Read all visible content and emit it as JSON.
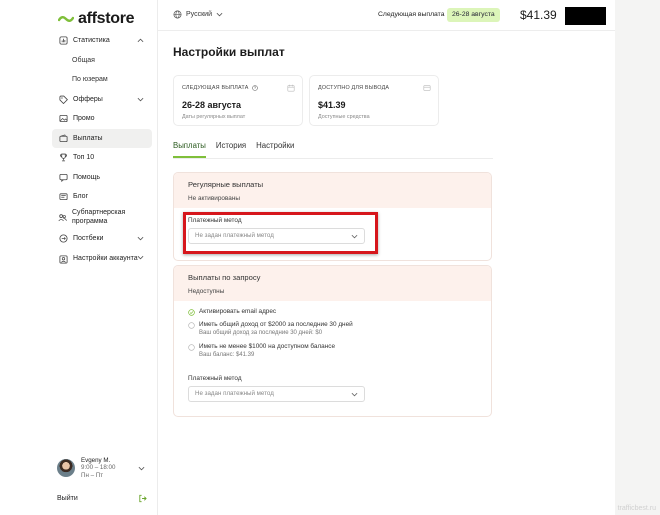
{
  "brand": {
    "name": "affstore",
    "accent": "#7fbf3a"
  },
  "sidebar": {
    "items": [
      {
        "label": "Статистика",
        "icon": "bar-chart-icon",
        "expanded": true,
        "children": [
          {
            "label": "Общая"
          },
          {
            "label": "По юзерам"
          }
        ]
      },
      {
        "label": "Офферы",
        "icon": "tag-icon",
        "chevron": true
      },
      {
        "label": "Промо",
        "icon": "image-icon"
      },
      {
        "label": "Выплаты",
        "icon": "wallet-icon",
        "active": true
      },
      {
        "label": "Топ 10",
        "icon": "trophy-icon"
      },
      {
        "label": "Помощь",
        "icon": "chat-icon"
      },
      {
        "label": "Блог",
        "icon": "doc-icon"
      },
      {
        "label": "Субпартнерская программа",
        "icon": "users-icon"
      },
      {
        "label": "Постбеки",
        "icon": "postback-icon",
        "chevron": true
      },
      {
        "label": "Настройки аккаунта",
        "icon": "user-settings-icon",
        "chevron": true
      }
    ],
    "user": {
      "name": "Evgeny M.",
      "hours": "9:00 – 18:00",
      "days": "Пн – Пт"
    },
    "logout_label": "Выйти"
  },
  "header": {
    "language": "Русский",
    "next_payout_label": "Следующая выплата",
    "next_payout_dates": "26-28 августа",
    "balance": "$41.39"
  },
  "main": {
    "title": "Настройки выплат",
    "cards": [
      {
        "caption": "Следующая выплата",
        "value": "26-28 августа",
        "hint": "Даты регулярных выплат"
      },
      {
        "caption": "Доступно для вывода",
        "value": "$41.39",
        "hint": "Доступные средства"
      }
    ],
    "tabs": [
      {
        "label": "Выплаты",
        "active": true
      },
      {
        "label": "История"
      },
      {
        "label": "Настройки"
      }
    ],
    "regular": {
      "title": "Регулярные выплаты",
      "status": "Не активированы",
      "method_label": "Платежный метод",
      "method_placeholder": "Не задан платежный метод"
    },
    "on_demand": {
      "title": "Выплаты по запросу",
      "status": "Недоступны",
      "requirements": [
        {
          "text": "Активировать email адрес",
          "done": true,
          "sub": ""
        },
        {
          "text": "Иметь общий доход от $2000 за последние 30 дней",
          "done": false,
          "sub": "Ваш общий доход за последние 30 дней: $0"
        },
        {
          "text": "Иметь не менее $1000 на доступном балансе",
          "done": false,
          "sub": "Ваш баланс: $41.39"
        }
      ],
      "method_label": "Платежный метод",
      "method_placeholder": "Не задан платежный метод"
    }
  },
  "watermark": "traffiсbest.ru"
}
